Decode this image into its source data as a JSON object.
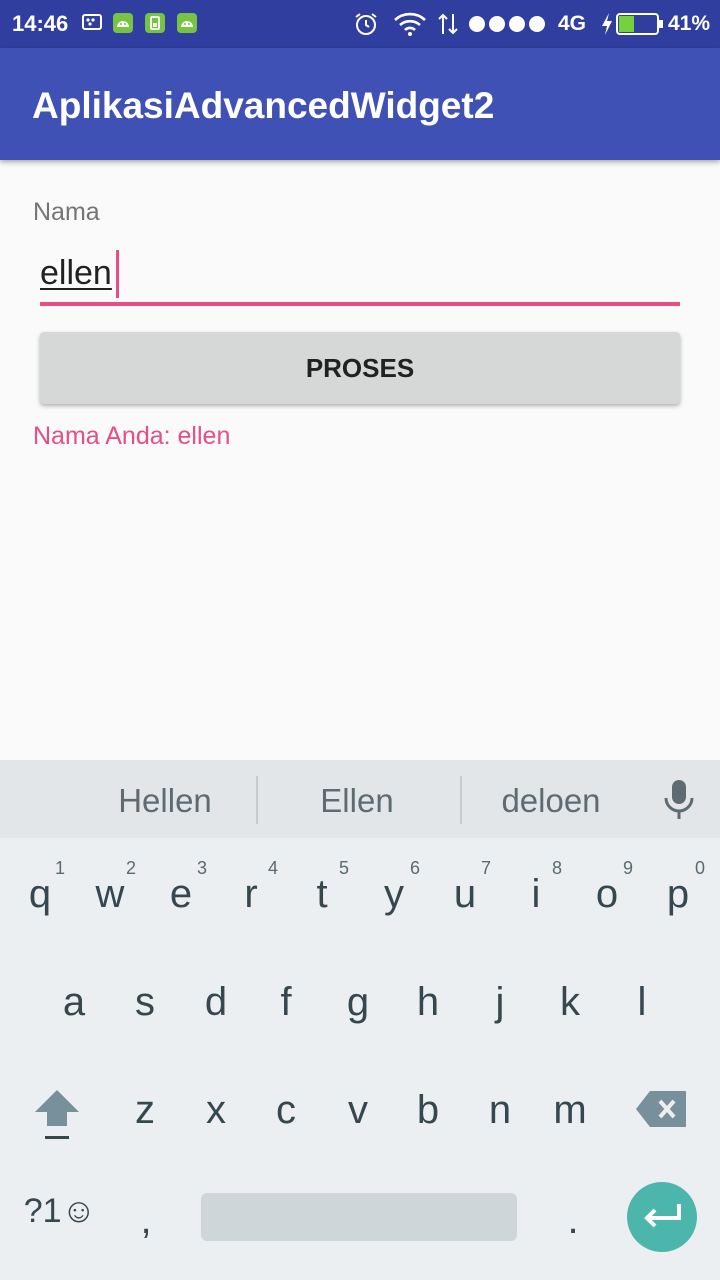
{
  "status_bar": {
    "time": "14:46",
    "network": "4G",
    "battery_percent": "41%",
    "battery_level": 0.41
  },
  "app_bar": {
    "title": "AplikasiAdvancedWidget2"
  },
  "form": {
    "name_label": "Nama",
    "name_value": "ellen",
    "process_button": "PROSES",
    "result_text": "Nama Anda: ellen"
  },
  "keyboard": {
    "suggestions": [
      "Hellen",
      "Ellen",
      "deloen"
    ],
    "row1": [
      "q",
      "w",
      "e",
      "r",
      "t",
      "y",
      "u",
      "i",
      "o",
      "p"
    ],
    "row1_hints": [
      "1",
      "2",
      "3",
      "4",
      "5",
      "6",
      "7",
      "8",
      "9",
      "0"
    ],
    "row2": [
      "a",
      "s",
      "d",
      "f",
      "g",
      "h",
      "j",
      "k",
      "l"
    ],
    "row3": [
      "z",
      "x",
      "c",
      "v",
      "b",
      "n",
      "m"
    ],
    "symbols_key": "?1☺",
    "comma_key": ",",
    "period_key": ".",
    "enter_color": "#4db6ac"
  },
  "colors": {
    "primary": "#3f51b5",
    "primary_dark": "#303f9f",
    "accent": "#e84d88"
  }
}
